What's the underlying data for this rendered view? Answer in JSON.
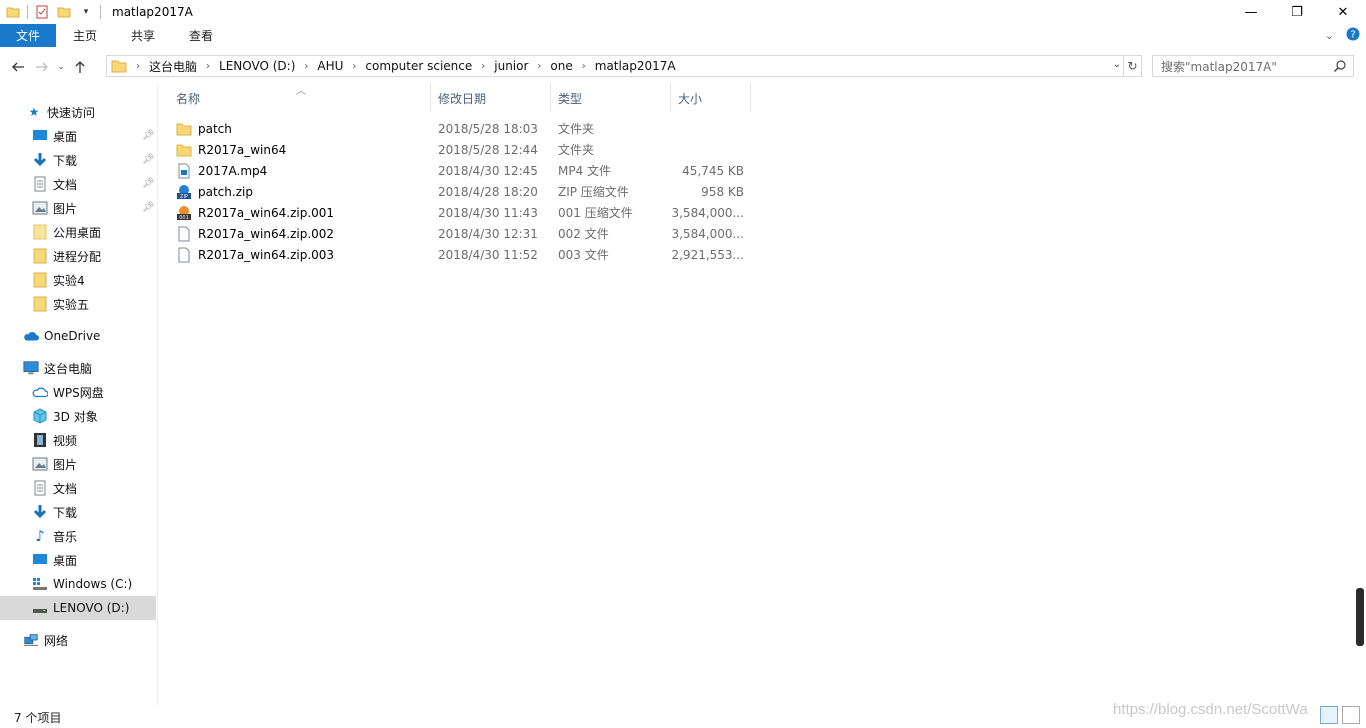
{
  "window": {
    "title": "matlap2017A",
    "minimize": "—",
    "maximize": "❐",
    "close": "✕"
  },
  "ribbon": {
    "tabs": [
      "文件",
      "主页",
      "共享",
      "查看"
    ]
  },
  "address": {
    "crumbs": [
      "这台电脑",
      "LENOVO (D:)",
      "AHU",
      "computer science",
      "junior",
      "one",
      "matlap2017A"
    ]
  },
  "search": {
    "placeholder": "搜索\"matlap2017A\""
  },
  "navpane": {
    "quick_access": "快速访问",
    "quick_items": [
      "桌面",
      "下载",
      "文档",
      "图片",
      "公用桌面",
      "进程分配",
      "实验4",
      "实验五"
    ],
    "onedrive": "OneDrive",
    "this_pc": "这台电脑",
    "pc_items": [
      "WPS网盘",
      "3D 对象",
      "视频",
      "图片",
      "文档",
      "下载",
      "音乐",
      "桌面",
      "Windows (C:)",
      "LENOVO (D:)"
    ],
    "network": "网络"
  },
  "columns": {
    "name": "名称",
    "date": "修改日期",
    "type": "类型",
    "size": "大小"
  },
  "files": [
    {
      "name": "patch",
      "date": "2018/5/28 18:03",
      "type": "文件夹",
      "size": "",
      "icon": "folder-icon"
    },
    {
      "name": "R2017a_win64",
      "date": "2018/5/28 12:44",
      "type": "文件夹",
      "size": "",
      "icon": "folder-icon"
    },
    {
      "name": "2017A.mp4",
      "date": "2018/4/30 12:45",
      "type": "MP4 文件",
      "size": "45,745 KB",
      "icon": "video-file-icon"
    },
    {
      "name": "patch.zip",
      "date": "2018/4/28 18:20",
      "type": "ZIP 压缩文件",
      "size": "958 KB",
      "icon": "zip-file-icon"
    },
    {
      "name": "R2017a_win64.zip.001",
      "date": "2018/4/30 11:43",
      "type": "001 压缩文件",
      "size": "3,584,000...",
      "icon": "archive-001-icon"
    },
    {
      "name": "R2017a_win64.zip.002",
      "date": "2018/4/30 12:31",
      "type": "002 文件",
      "size": "3,584,000...",
      "icon": "blank-file-icon"
    },
    {
      "name": "R2017a_win64.zip.003",
      "date": "2018/4/30 11:52",
      "type": "003 文件",
      "size": "2,921,553...",
      "icon": "blank-file-icon"
    }
  ],
  "status": {
    "count": "7 个项目"
  },
  "watermark": "https://blog.csdn.net/ScottWa"
}
